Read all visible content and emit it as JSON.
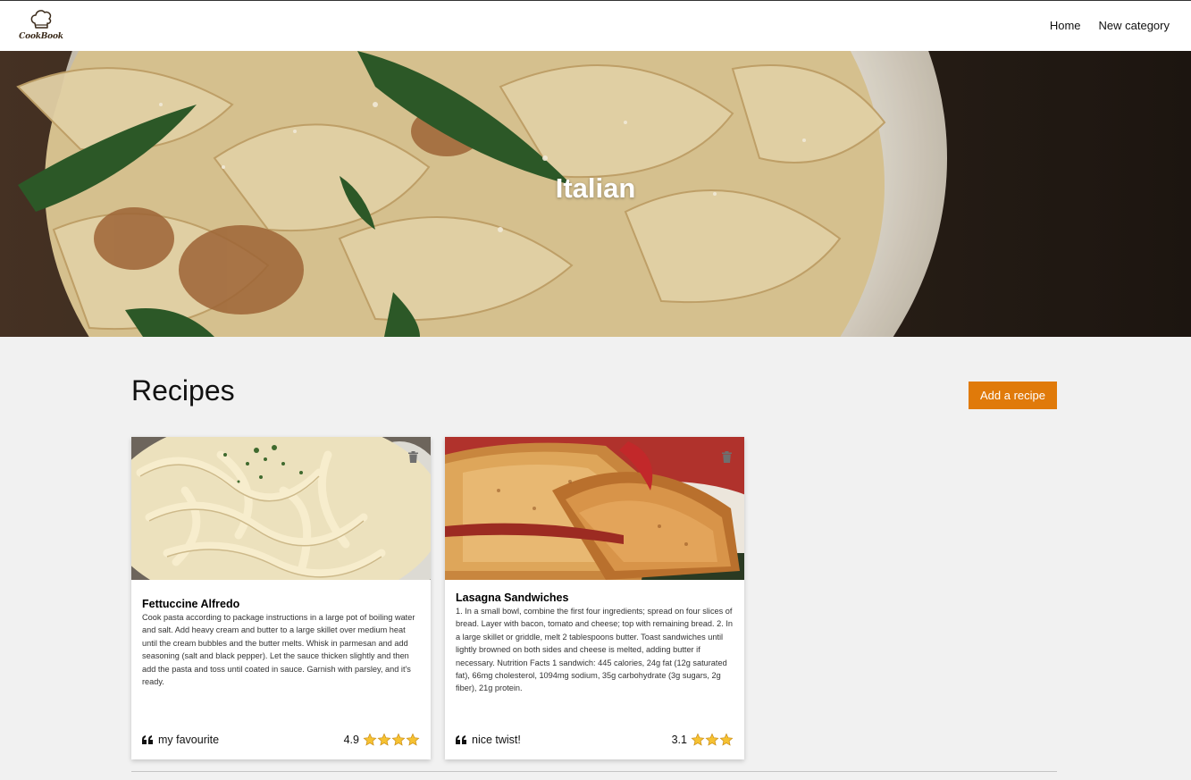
{
  "brand": {
    "name": "CookBook"
  },
  "nav": {
    "items": [
      {
        "label": "Home"
      },
      {
        "label": "New category"
      }
    ]
  },
  "hero": {
    "title": "Italian"
  },
  "section": {
    "title": "Recipes",
    "add_button": "Add a recipe"
  },
  "recipes": [
    {
      "title": "Fettuccine Alfredo",
      "description": "Cook pasta according to package instructions in a large pot of boiling water and salt. Add heavy cream and butter to a large skillet over medium heat until the cream bubbles and the butter melts. Whisk in parmesan and add seasoning (salt and black pepper). Let the sauce thicken slightly and then add the pasta and toss until coated in sauce. Garnish with parsley, and it's ready.",
      "comment": "my favourite",
      "rating": "4.9",
      "stars": 4
    },
    {
      "title": "Lasagna Sandwiches",
      "description": "1. In a small bowl, combine the first four ingredients; spread on four slices of bread. Layer with bacon, tomato and cheese; top with remaining bread. 2. In a large skillet or griddle, melt 2 tablespoons butter. Toast sandwiches until lightly browned on both sides and cheese is melted, adding butter if necessary. Nutrition Facts 1 sandwich: 445 calories, 24g fat (12g saturated fat), 66mg cholesterol, 1094mg sodium, 35g carbohydrate (3g sugars, 2g fiber), 21g protein.",
      "comment": "nice twist!",
      "rating": "3.1",
      "stars": 3
    }
  ],
  "colors": {
    "accent": "#e07a0a",
    "star": "#f6c232",
    "page_bg": "#f1f1f1"
  },
  "icons": {
    "logo": "chef-hat-icon",
    "delete": "trash-icon",
    "comment": "quote-icon",
    "rating": "star-icon"
  }
}
